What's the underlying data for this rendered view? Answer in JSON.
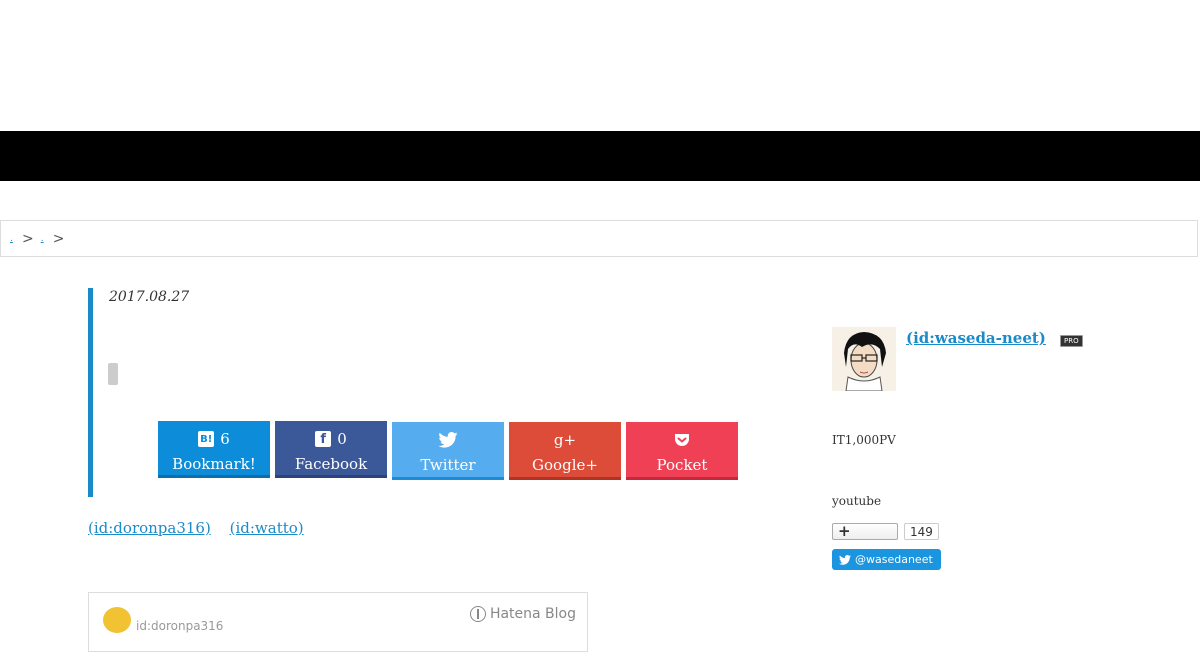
{
  "breadcrumb": {
    "items": [
      {
        "label": "."
      },
      {
        "label": "."
      }
    ],
    "separator": ">"
  },
  "entry": {
    "date": "2017.08.27"
  },
  "share": {
    "hatena": {
      "count": "6",
      "label": "Bookmark!",
      "icon_text": "B!"
    },
    "facebook": {
      "count": "0",
      "label": "Facebook",
      "icon_text": "f"
    },
    "twitter": {
      "label": "Twitter"
    },
    "googleplus": {
      "label": "Google+",
      "icon_text": "g+"
    },
    "pocket": {
      "label": "Pocket"
    }
  },
  "ids": [
    "(id:doronpa316)",
    "(id:watto)"
  ],
  "embed": {
    "id_text": "id:doronpa316",
    "brand": "Hatena Blog"
  },
  "sidebar": {
    "profile_id": "(id:waseda-neet)",
    "pro_badge": "PRO",
    "pv_text": "IT1,000PV",
    "youtube_text": "youtube",
    "follow_count": "149",
    "twitter_handle": "@wasedaneet"
  },
  "colors": {
    "accent": "#1a8ac8",
    "hatena": "#0d8dd9",
    "facebook": "#3b5998",
    "twitter": "#55acee",
    "googleplus": "#dd4b39",
    "pocket": "#ef4056"
  }
}
